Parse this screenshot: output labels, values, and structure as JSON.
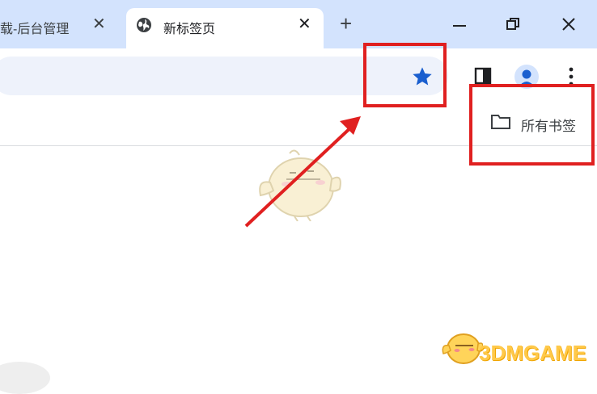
{
  "tabs": [
    {
      "title": "载-后台管理",
      "close_label": "✕",
      "active": false
    },
    {
      "title": "新标签页",
      "close_label": "✕",
      "active": true
    }
  ],
  "new_tab_label": "+",
  "window_controls": {
    "minimize": "—",
    "close": "✕"
  },
  "toolbar": {
    "star_icon": "star-icon",
    "sidepanel_icon": "side-panel-icon",
    "avatar_icon": "profile-avatar-icon",
    "menu_icon": "more-vert-icon"
  },
  "bookmarks_bar": {
    "folder_label": "所有书签"
  },
  "watermark": {
    "text": "3DMGAME"
  },
  "colors": {
    "tabstrip": "#d3e3fd",
    "omnibox": "#eef2fb",
    "star": "#1a5fcf",
    "highlight": "#e02020",
    "watermark": "#ffc94a"
  }
}
